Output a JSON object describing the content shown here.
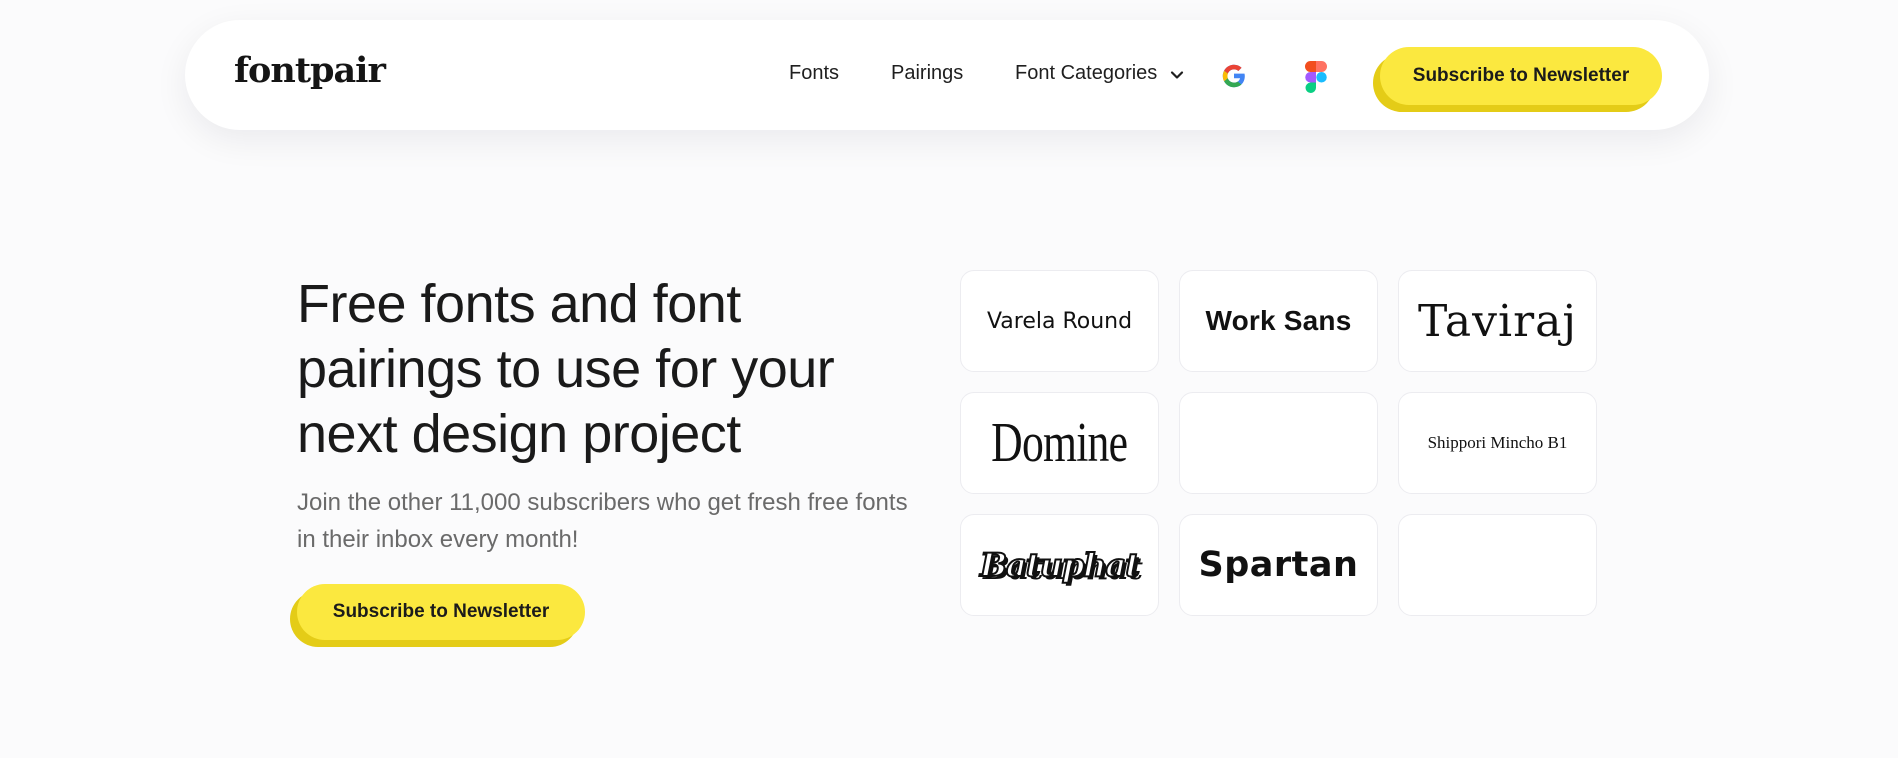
{
  "nav": {
    "logo": "fontpair",
    "links": {
      "fonts": "Fonts",
      "pairings": "Pairings",
      "categories": "Font Categories"
    },
    "icons": [
      "google-icon",
      "figma-icon",
      "chevron-down-icon"
    ],
    "subscribe_label": "Subscribe to Newsletter"
  },
  "hero": {
    "heading": "Free fonts and font pairings to use for your next design project",
    "subheading": "Join the other 11,000 subscribers who get fresh free fonts in their inbox every month!",
    "subscribe_label": "Subscribe to Newsletter"
  },
  "font_grid": {
    "cards": [
      {
        "label": "Varela Round"
      },
      {
        "label": "Work Sans"
      },
      {
        "label": "Taviraj"
      },
      {
        "label": "Domine"
      },
      {
        "label": ""
      },
      {
        "label": "Shippori Mincho B1"
      },
      {
        "label": "Batuphat"
      },
      {
        "label": "Spartan"
      },
      {
        "label": ""
      }
    ]
  },
  "colors": {
    "accent_yellow": "#fbe83f",
    "accent_shadow": "#e4cc17",
    "background": "#fbfbfc",
    "text_primary": "#1a1a1a",
    "text_secondary": "#6a6a6a"
  }
}
